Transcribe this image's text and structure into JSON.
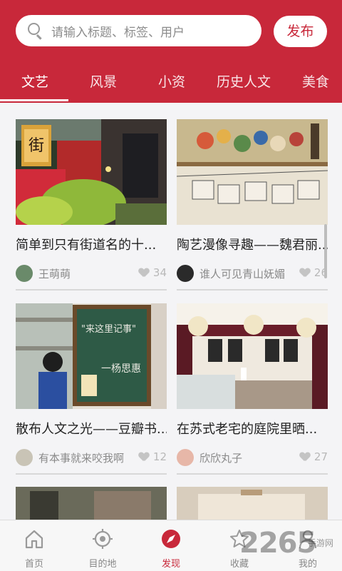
{
  "search": {
    "placeholder": "请输入标题、标签、用户"
  },
  "header": {
    "publish_label": "发布"
  },
  "tabs": [
    "文艺",
    "风景",
    "小资",
    "历史人文",
    "美食"
  ],
  "active_tab": "文艺",
  "cards": [
    {
      "title": "简单到只有街道名的十...",
      "author": "王萌萌",
      "likes": "34",
      "image": "street-shop-photo"
    },
    {
      "title": "陶艺漫像寻趣——魏君丽...",
      "author": "谁人可见青山妩媚",
      "likes": "26",
      "image": "figurine-shelf-photo"
    },
    {
      "title": "散布人文之光——豆瓣书...",
      "author": "有本事就来咬我啊",
      "likes": "12",
      "image": "bookstore-chalkboard-photo"
    },
    {
      "title": "在苏式老宅的庭院里晒...",
      "author": "欣欣丸子",
      "likes": "27",
      "image": "cafe-interior-photo"
    }
  ],
  "bottom_nav": [
    {
      "label": "首页",
      "icon": "home-icon"
    },
    {
      "label": "目的地",
      "icon": "location-target-icon"
    },
    {
      "label": "发现",
      "icon": "compass-icon"
    },
    {
      "label": "收藏",
      "icon": "star-icon"
    },
    {
      "label": "我的",
      "icon": "user-icon"
    }
  ],
  "active_nav": "发现",
  "watermark": {
    "text": "2265",
    "sub": "手游网"
  },
  "colors": {
    "brand": "#c8283a",
    "background": "#f4f4f6"
  }
}
